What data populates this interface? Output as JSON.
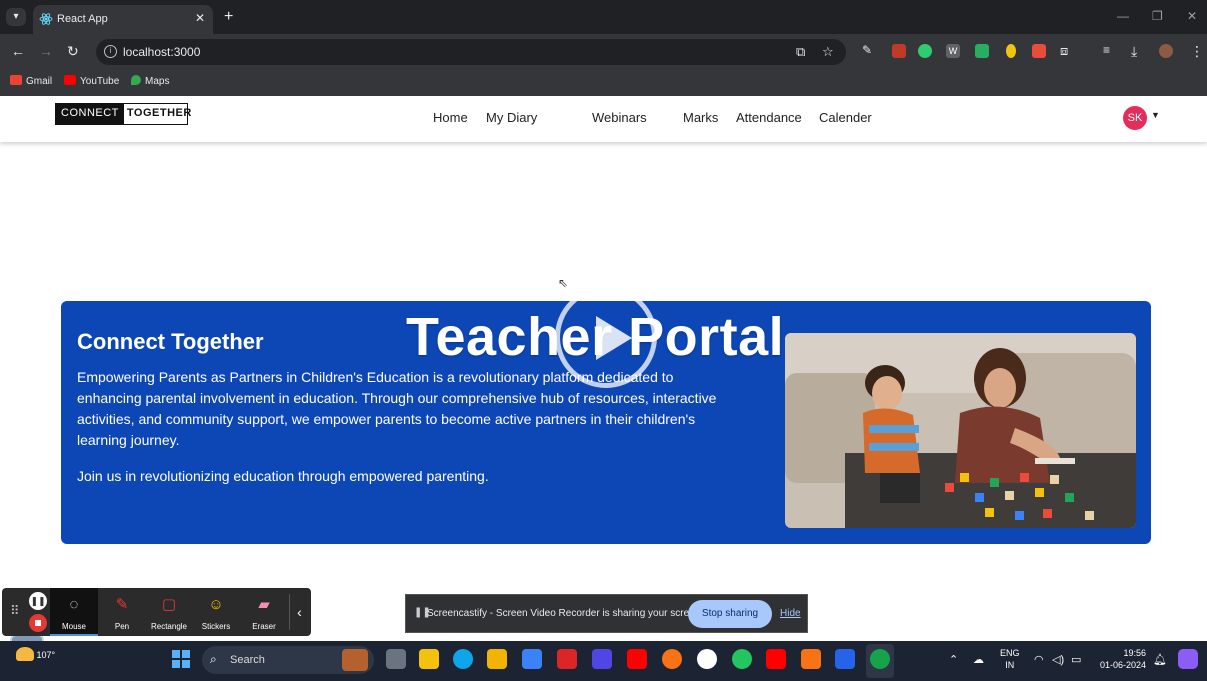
{
  "browser": {
    "tab_title": "React App",
    "url": "localhost:3000",
    "bookmarks": [
      "Gmail",
      "YouTube",
      "Maps"
    ]
  },
  "site": {
    "logo_part1": "CONNECT",
    "logo_part2": "TOGETHER",
    "nav": [
      "Home",
      "My Diary",
      "Webinars",
      "Marks",
      "Attendance",
      "Calender"
    ],
    "avatar_initials": "SK"
  },
  "hero": {
    "title": "Connect Together",
    "description": "Empowering Parents as Partners in Children's Education is a revolutionary platform dedicated to enhancing parental involvement in education. Through our comprehensive hub of resources, interactive activities, and community support, we empower parents to become active partners in their children's learning journey.",
    "join_text": "Join us in revolutionizing education through empowered parenting."
  },
  "video_overlay": {
    "title": "Teacher Portal"
  },
  "recorder_tools": [
    {
      "name": "mouse",
      "label": "Mouse"
    },
    {
      "name": "pen",
      "label": "Pen"
    },
    {
      "name": "rectangle",
      "label": "Rectangle"
    },
    {
      "name": "stickers",
      "label": "Stickers"
    },
    {
      "name": "eraser",
      "label": "Eraser"
    }
  ],
  "share_bar": {
    "message": "Screencastify - Screen Video Recorder is sharing your screen.",
    "stop_label": "Stop sharing",
    "hide_label": "Hide"
  },
  "taskbar": {
    "weather": "107°",
    "search_placeholder": "Search",
    "lang_line1": "ENG",
    "lang_line2": "IN",
    "time": "19:56",
    "date": "01-06-2024"
  },
  "colors": {
    "hero_bg": "#0d47b5",
    "avatar_bg": "#e52d5a",
    "stop_sharing_bg": "#a8c7fa"
  }
}
